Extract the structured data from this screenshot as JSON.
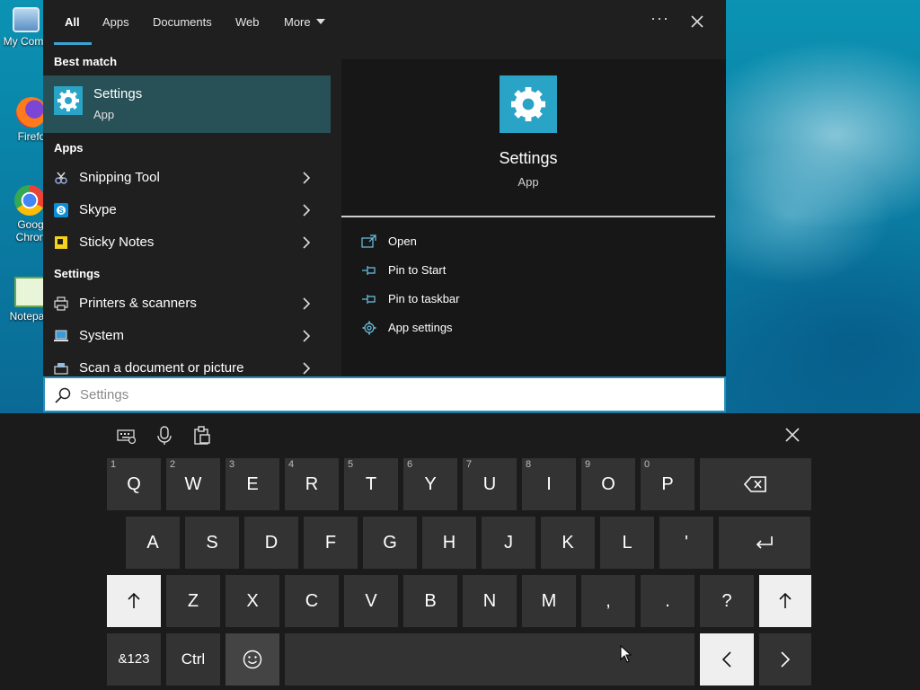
{
  "desktop": {
    "icons": [
      {
        "label": "My Com",
        "name": "desktop-icon-my-computer"
      },
      {
        "label": "Firefo",
        "name": "desktop-icon-firefox"
      },
      {
        "label": "Goog",
        "label2": "Chron",
        "name": "desktop-icon-chrome"
      },
      {
        "label": "Notepa",
        "name": "desktop-icon-notepad"
      }
    ]
  },
  "search_panel": {
    "tabs": [
      {
        "label": "All",
        "active": true
      },
      {
        "label": "Apps"
      },
      {
        "label": "Documents"
      },
      {
        "label": "Web"
      },
      {
        "label": "More",
        "has_caret": true
      }
    ],
    "more_options": "···",
    "best_match": {
      "heading": "Best match",
      "title": "Settings",
      "subtitle": "App",
      "icon": "gear-icon"
    },
    "apps_heading": "Apps",
    "apps": [
      {
        "label": "Snipping Tool",
        "icon": "snipping-tool-icon"
      },
      {
        "label": "Skype",
        "icon": "skype-icon"
      },
      {
        "label": "Sticky Notes",
        "icon": "sticky-notes-icon"
      }
    ],
    "settings_heading": "Settings",
    "settings": [
      {
        "label": "Printers & scanners",
        "icon": "printer-icon"
      },
      {
        "label": "System",
        "icon": "laptop-icon"
      },
      {
        "label": "Scan a document or picture",
        "icon": "scanner-icon"
      }
    ],
    "preview": {
      "title": "Settings",
      "subtitle": "App",
      "icon": "gear-icon",
      "actions": [
        {
          "label": "Open",
          "icon": "open-icon"
        },
        {
          "label": "Pin to Start",
          "icon": "pin-icon"
        },
        {
          "label": "Pin to taskbar",
          "icon": "pin-icon"
        },
        {
          "label": "App settings",
          "icon": "gear-icon"
        }
      ]
    }
  },
  "search": {
    "value": "S",
    "placeholder": "Settings"
  },
  "keyboard": {
    "toolbar": [
      {
        "name": "keyboard-settings-icon"
      },
      {
        "name": "microphone-icon"
      },
      {
        "name": "clipboard-icon"
      }
    ],
    "row1": [
      {
        "k": "Q",
        "h": "1"
      },
      {
        "k": "W",
        "h": "2"
      },
      {
        "k": "E",
        "h": "3"
      },
      {
        "k": "R",
        "h": "4"
      },
      {
        "k": "T",
        "h": "5"
      },
      {
        "k": "Y",
        "h": "6"
      },
      {
        "k": "U",
        "h": "7"
      },
      {
        "k": "I",
        "h": "8"
      },
      {
        "k": "O",
        "h": "9"
      },
      {
        "k": "P",
        "h": "0"
      }
    ],
    "row2": [
      "A",
      "S",
      "D",
      "F",
      "G",
      "H",
      "J",
      "K",
      "L",
      "'"
    ],
    "row3": [
      "Z",
      "X",
      "C",
      "V",
      "B",
      "N",
      "M",
      ",",
      ".",
      "?"
    ],
    "symbols_label": "&123",
    "ctrl_label": "Ctrl"
  }
}
